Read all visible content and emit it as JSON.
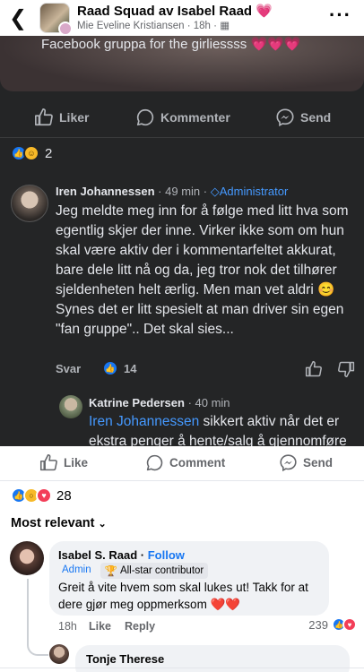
{
  "header": {
    "title": "Raad Squad av Isabel Raad",
    "title_emoji": "💗",
    "author": "Mie Eveline Kristiansen",
    "time": "18h"
  },
  "embedded_post": {
    "caption": "Facebook gruppa for the girliessss",
    "caption_emoji": "💗💗💗",
    "actions": {
      "like": "Liker",
      "comment": "Kommenter",
      "share": "Send"
    },
    "reaction_count": "2",
    "comment1": {
      "author": "Iren Johannessen",
      "time": "49 min",
      "role": "Administrator",
      "text1": "Jeg meldte meg inn for å følge med litt hva som egentlig skjer der inne. Virker ikke som om hun skal være aktiv der i kommentarfeltet akkurat, bare dele litt nå og da, jeg tror nok det tilhører sjeldenheten helt ærlig. Men man vet aldri 😊",
      "text2": "Synes det er litt spesielt at man driver sin egen \"fan gruppe\".. Det skal sies...",
      "reply_label": "Svar",
      "likes": "14"
    },
    "comment2": {
      "author": "Katrine Pedersen",
      "time": "40 min",
      "mention": "Iren Johannessen",
      "text": "sikkert aktiv når det er ekstra penger å hente/salg å gjennomføre"
    }
  },
  "post_actions": {
    "like": "Like",
    "comment": "Comment",
    "share": "Send"
  },
  "post_reaction_count": "28",
  "sort_label": "Most relevant",
  "top_comment": {
    "author": "Isabel S. Raad",
    "follow": "Follow",
    "badge_admin": "Admin",
    "badge_star": "All-star contributor",
    "text": "Greit å vite hvem som skal lukes ut! Takk for at dere gjør meg oppmerksom",
    "text_emoji": "❤️❤️",
    "time": "18h",
    "like": "Like",
    "reply": "Reply",
    "reaction_count": "239"
  },
  "reply_comment": {
    "author": "Tonje Therese"
  }
}
